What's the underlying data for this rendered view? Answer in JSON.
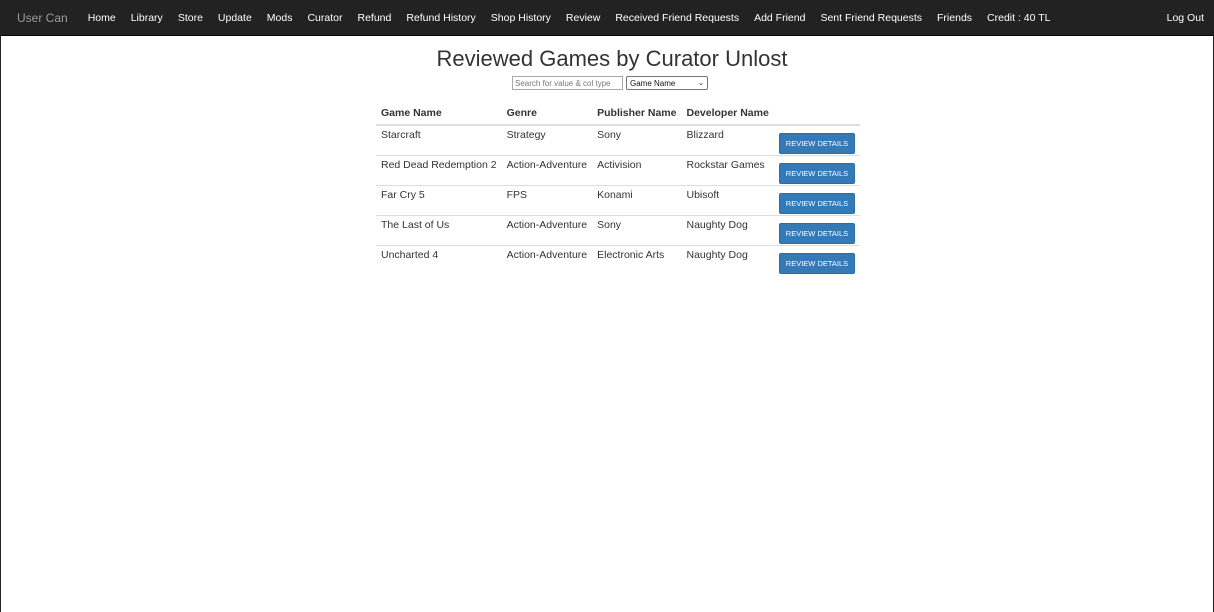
{
  "navbar": {
    "brand": "User Can",
    "links": [
      {
        "label": "Home"
      },
      {
        "label": "Library"
      },
      {
        "label": "Store"
      },
      {
        "label": "Update"
      },
      {
        "label": "Mods"
      },
      {
        "label": "Curator"
      },
      {
        "label": "Refund"
      },
      {
        "label": "Refund History"
      },
      {
        "label": "Shop History"
      },
      {
        "label": "Review"
      },
      {
        "label": "Received Friend Requests"
      },
      {
        "label": "Add Friend"
      },
      {
        "label": "Sent Friend Requests"
      },
      {
        "label": "Friends"
      }
    ],
    "credit": "Credit : 40 TL",
    "logout": "Log Out"
  },
  "page": {
    "title": "Reviewed Games by Curator Unlost",
    "search": {
      "placeholder": "Search for value & col type",
      "value": ""
    },
    "column_select": {
      "selected": "Game Name"
    }
  },
  "table": {
    "headers": [
      "Game Name",
      "Genre",
      "Publisher Name",
      "Developer Name"
    ],
    "button_label": "REVIEW DETAILS",
    "rows": [
      {
        "game": "Starcraft",
        "genre": "Strategy",
        "publisher": "Sony",
        "developer": "Blizzard"
      },
      {
        "game": "Red Dead Redemption 2",
        "genre": "Action-Adventure",
        "publisher": "Activision",
        "developer": "Rockstar Games"
      },
      {
        "game": "Far Cry 5",
        "genre": "FPS",
        "publisher": "Konami",
        "developer": "Ubisoft"
      },
      {
        "game": "The Last of Us",
        "genre": "Action-Adventure",
        "publisher": "Sony",
        "developer": "Naughty Dog"
      },
      {
        "game": "Uncharted 4",
        "genre": "Action-Adventure",
        "publisher": "Electronic Arts",
        "developer": "Naughty Dog"
      }
    ]
  },
  "colors": {
    "navbar_bg": "#222222",
    "brand_text": "#9d9d9d",
    "button_primary": "#337ab7",
    "row_border": "#dddddd"
  }
}
